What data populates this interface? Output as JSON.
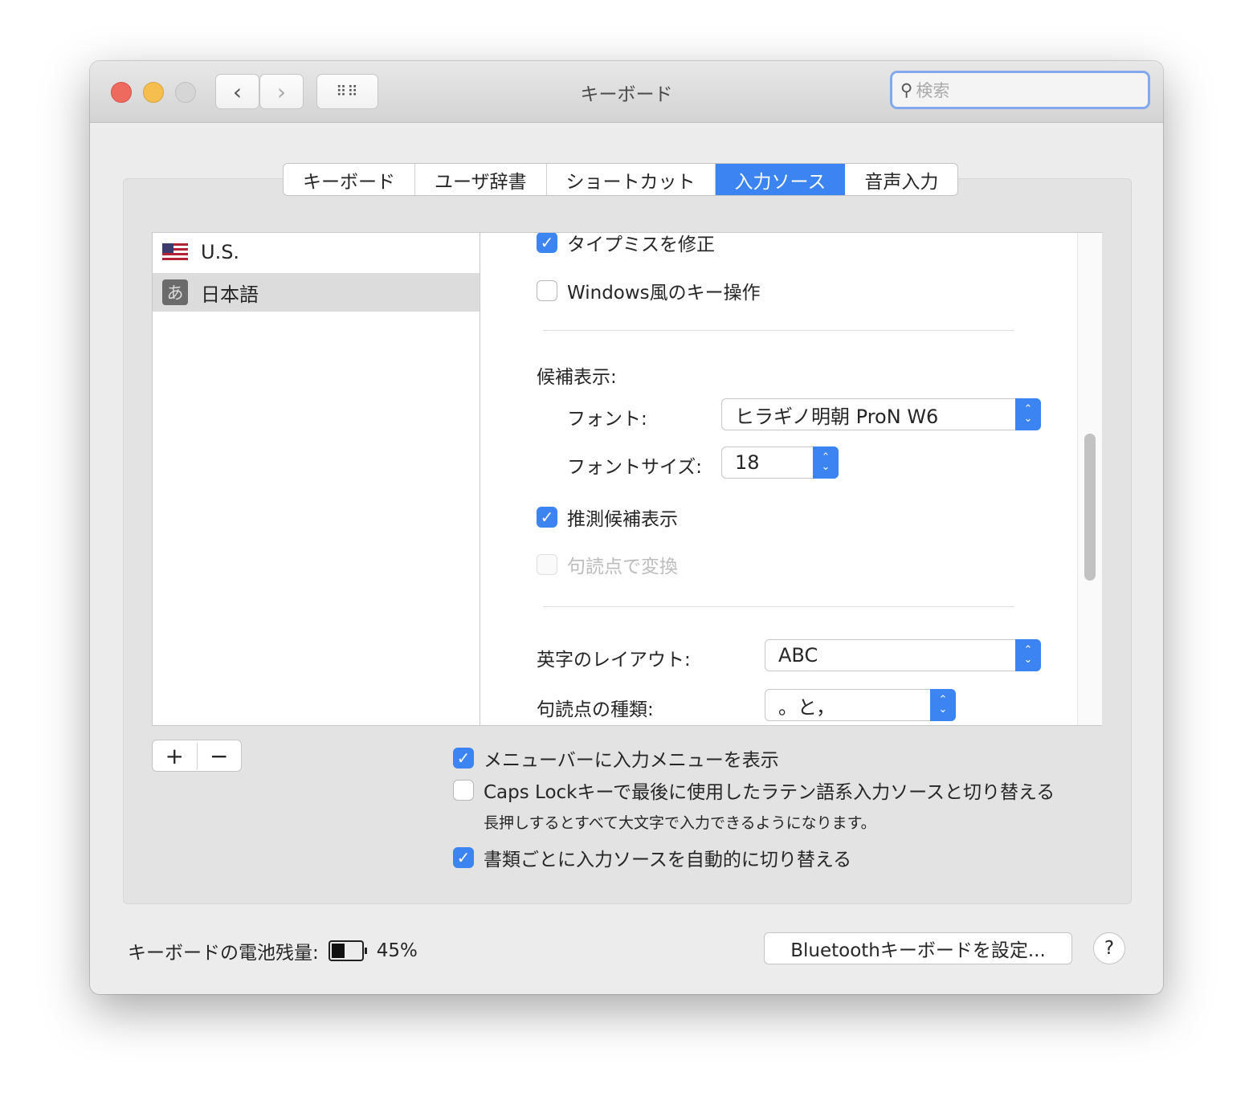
{
  "window": {
    "title": "キーボード",
    "search_placeholder": "検索"
  },
  "tabs": [
    "キーボード",
    "ユーザ辞書",
    "ショートカット",
    "入力ソース",
    "音声入力"
  ],
  "sources": [
    {
      "label": "U.S.",
      "icon": "us-flag-icon"
    },
    {
      "label": "日本語",
      "icon": "hiragana-a-icon",
      "glyph": "あ"
    }
  ],
  "options": {
    "typo": "タイプミスを修正",
    "windows_keys": "Windows風のキー操作",
    "candidates_heading": "候補表示:",
    "font_label": "フォント:",
    "font_value": "ヒラギノ明朝 ProN W6",
    "font_size_label": "フォントサイズ:",
    "font_size_value": "18",
    "predictive": "推測候補表示",
    "punct_convert": "句読点で変換",
    "layout_label": "英字のレイアウト:",
    "layout_value": "ABC",
    "punct_label": "句読点の種類:",
    "punct_value": "。と，"
  },
  "bottom": {
    "add": "+",
    "remove": "−",
    "show_menu": "メニューバーに入力メニューを表示",
    "caps_lock": "Caps Lockキーで最後に使用したラテン語系入力ソースと切り替える",
    "caps_note": "長押しするとすべて大文字で入力できるようになります。",
    "auto_switch": "書類ごとに入力ソースを自動的に切り替える"
  },
  "footer": {
    "battery_label": "キーボードの電池残量:",
    "battery_percent": "45%",
    "battery_level": 0.45,
    "bluetooth_button": "Bluetoothキーボードを設定...",
    "help": "?"
  },
  "colors": {
    "accent": "#3b84f1"
  }
}
